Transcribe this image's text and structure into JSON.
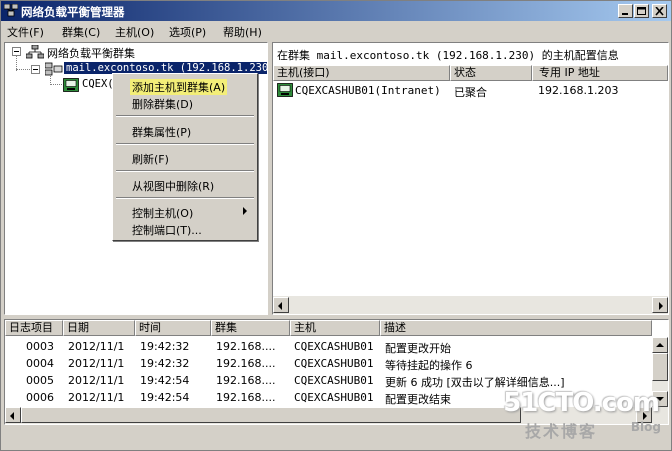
{
  "window": {
    "title": "网络负载平衡管理器",
    "controls": [
      "minimize-icon",
      "maximize-icon",
      "close-icon"
    ]
  },
  "menubar": {
    "items": [
      "文件(F)",
      "群集(C)",
      "主机(O)",
      "选项(P)",
      "帮助(H)"
    ]
  },
  "tree": {
    "root_label": "网络负载平衡群集",
    "cluster_label": "mail.excontoso.tk (192.168.1.230)",
    "host_label": "CQEX("
  },
  "context_menu": {
    "items": [
      {
        "label": "添加主机到群集(A)",
        "highlighted": true
      },
      {
        "label": "删除群集(D)"
      },
      {
        "separator": true
      },
      {
        "label": "群集属性(P)"
      },
      {
        "separator": true
      },
      {
        "label": "刷新(F)"
      },
      {
        "separator": true
      },
      {
        "label": "从视图中删除(R)"
      },
      {
        "separator": true
      },
      {
        "label": "控制主机(O)",
        "submenu": true
      },
      {
        "label": "控制端口(T)..."
      }
    ]
  },
  "hosts_panel": {
    "caption": "在群集 mail.excontoso.tk (192.168.1.230) 的主机配置信息",
    "columns": [
      "主机(接口)",
      "状态",
      "专用 IP 地址"
    ],
    "rows": [
      {
        "host": "CQEXCASHUB01(Intranet)",
        "status": "已聚合",
        "ip": "192.168.1.203"
      }
    ]
  },
  "log_panel": {
    "columns": [
      "日志项目",
      "日期",
      "时间",
      "群集",
      "主机",
      "描述"
    ],
    "rows": [
      {
        "id": "0003",
        "date": "2012/11/1",
        "time": "19:42:32",
        "cluster": "192.168....",
        "host": "CQEXCASHUB01",
        "desc": "配置更改开始"
      },
      {
        "id": "0004",
        "date": "2012/11/1",
        "time": "19:42:32",
        "cluster": "192.168....",
        "host": "CQEXCASHUB01",
        "desc": "等待挂起的操作 6"
      },
      {
        "id": "0005",
        "date": "2012/11/1",
        "time": "19:42:54",
        "cluster": "192.168....",
        "host": "CQEXCASHUB01",
        "desc": "更新 6 成功 [双击以了解详细信息...]"
      },
      {
        "id": "0006",
        "date": "2012/11/1",
        "time": "19:42:54",
        "cluster": "192.168....",
        "host": "CQEXCASHUB01",
        "desc": "配置更改结束"
      }
    ]
  },
  "watermark": {
    "brand": "51CTO.com",
    "subtitle": "技术博客",
    "tag": "Blog"
  }
}
